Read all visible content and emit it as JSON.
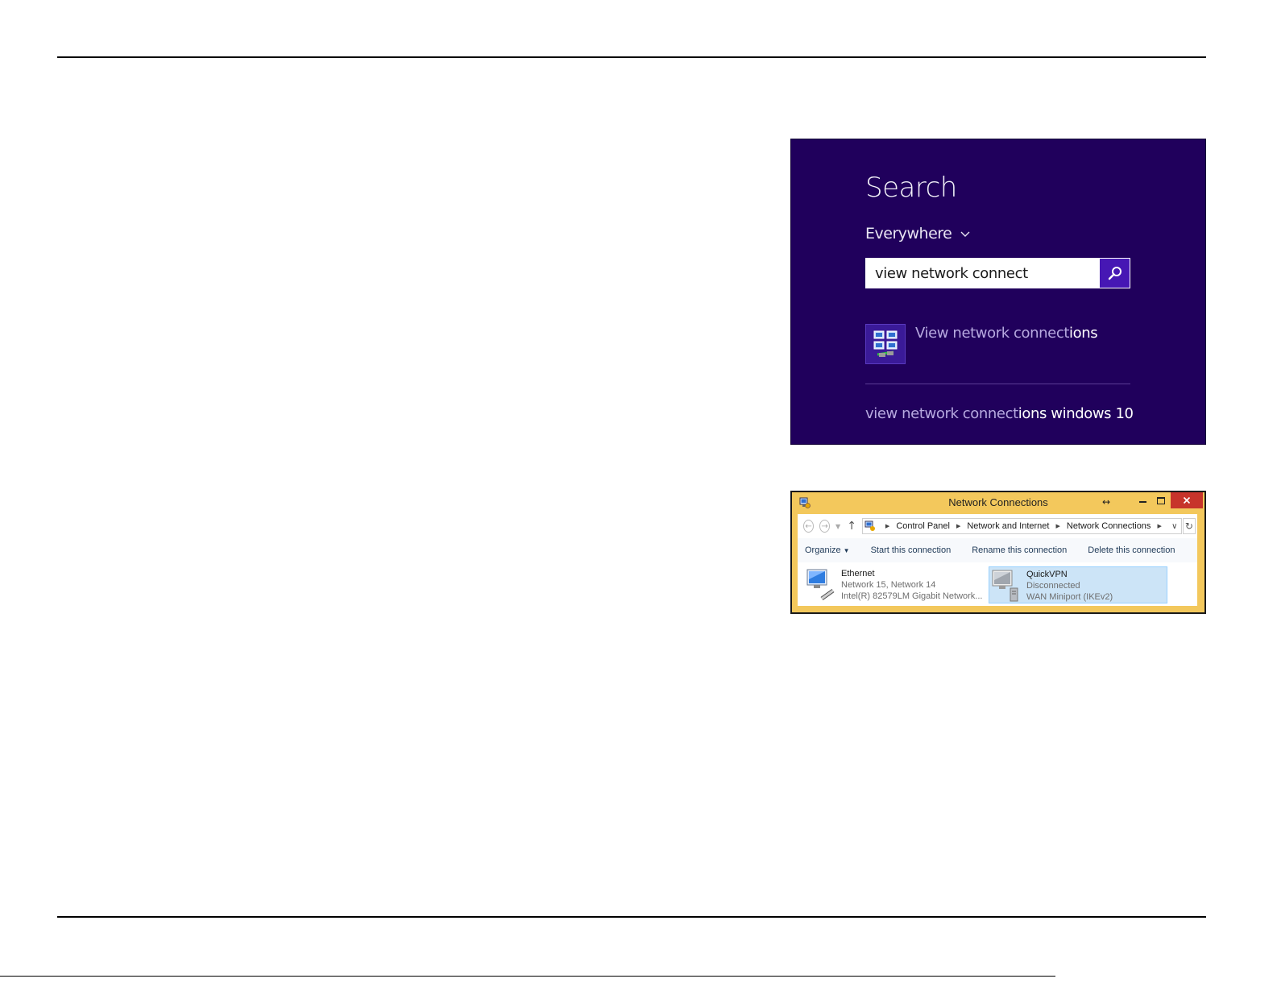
{
  "search_charm": {
    "title": "Search",
    "scope": "Everywhere",
    "query": "view network connect",
    "result": {
      "typed_part": "View network connect",
      "rest": "ions",
      "icon": "network-connections-icon"
    },
    "suggestion": {
      "typed_part": "view network connect",
      "rest": "ions windows 10"
    },
    "colors": {
      "background": "#20005c",
      "button": "#4617b4"
    }
  },
  "explorer": {
    "title": "Network Connections",
    "breadcrumbs": [
      "Control Panel",
      "Network and Internet",
      "Network Connections"
    ],
    "commands": {
      "organize": "Organize",
      "start": "Start this connection",
      "rename": "Rename this connection",
      "delete": "Delete this connection"
    },
    "connections": [
      {
        "name": "Ethernet",
        "line2": "Network  15, Network  14",
        "line3": "Intel(R) 82579LM Gigabit Network..."
      },
      {
        "name": "QuickVPN",
        "line2": "Disconnected",
        "line3": "WAN Miniport (IKEv2)"
      }
    ],
    "colors": {
      "frame": "#f3c85c",
      "close": "#c7342b",
      "selection": "#cce4f7"
    }
  }
}
